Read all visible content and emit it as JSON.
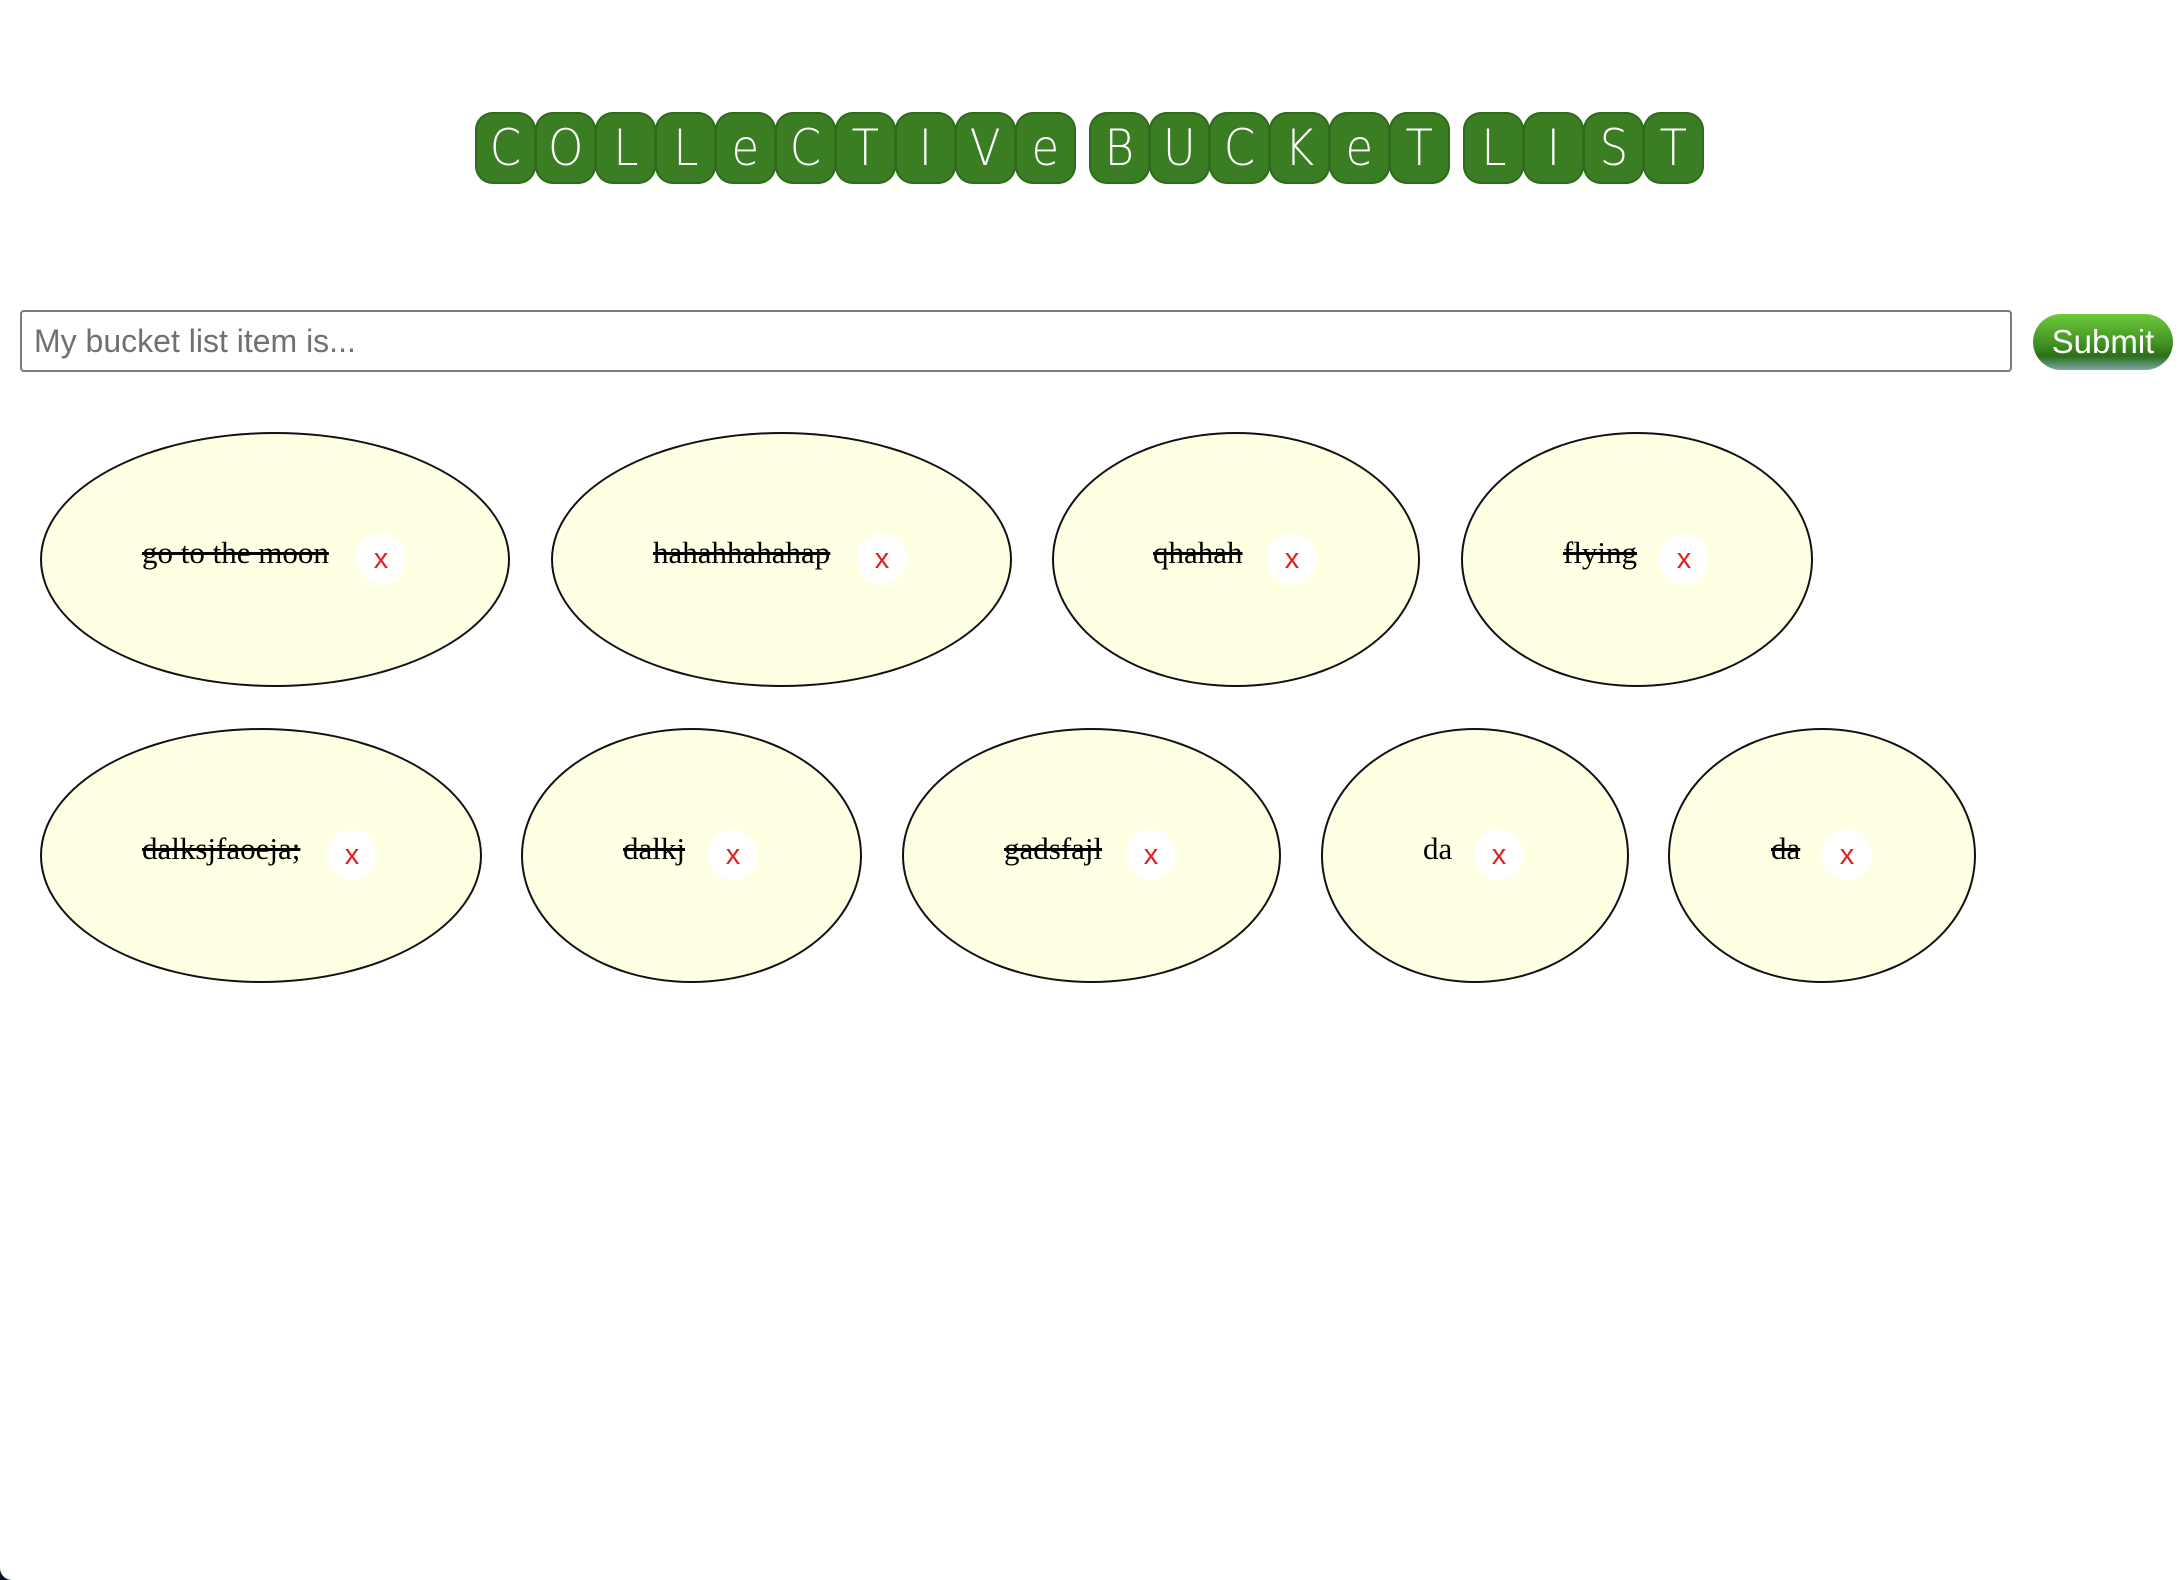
{
  "title": {
    "words": [
      [
        "C",
        "O",
        "L",
        "L",
        "e",
        "C",
        "T",
        "I",
        "V",
        "e"
      ],
      [
        "B",
        "U",
        "C",
        "K",
        "e",
        "T"
      ],
      [
        "L",
        "I",
        "S",
        "T"
      ]
    ]
  },
  "form": {
    "placeholder": "My bucket list item is...",
    "value": "",
    "submit_label": "Submit"
  },
  "items": [
    {
      "text": "go to the moon",
      "completed": true,
      "delete_label": "x"
    },
    {
      "text": "hahahhahahap",
      "completed": true,
      "delete_label": "x"
    },
    {
      "text": "qhahah",
      "completed": true,
      "delete_label": "x"
    },
    {
      "text": "flying",
      "completed": true,
      "delete_label": "x"
    },
    {
      "text": "dalksjfaoeja;",
      "completed": true,
      "delete_label": "x"
    },
    {
      "text": "dalkj",
      "completed": true,
      "delete_label": "x"
    },
    {
      "text": "gadsfajl",
      "completed": true,
      "delete_label": "x"
    },
    {
      "text": "da",
      "completed": false,
      "delete_label": "x"
    },
    {
      "text": "da",
      "completed": true,
      "delete_label": "x"
    }
  ],
  "colors": {
    "title_tile": "#3a7d22",
    "item_background": "#ffffe4",
    "delete_text": "#e02020"
  }
}
